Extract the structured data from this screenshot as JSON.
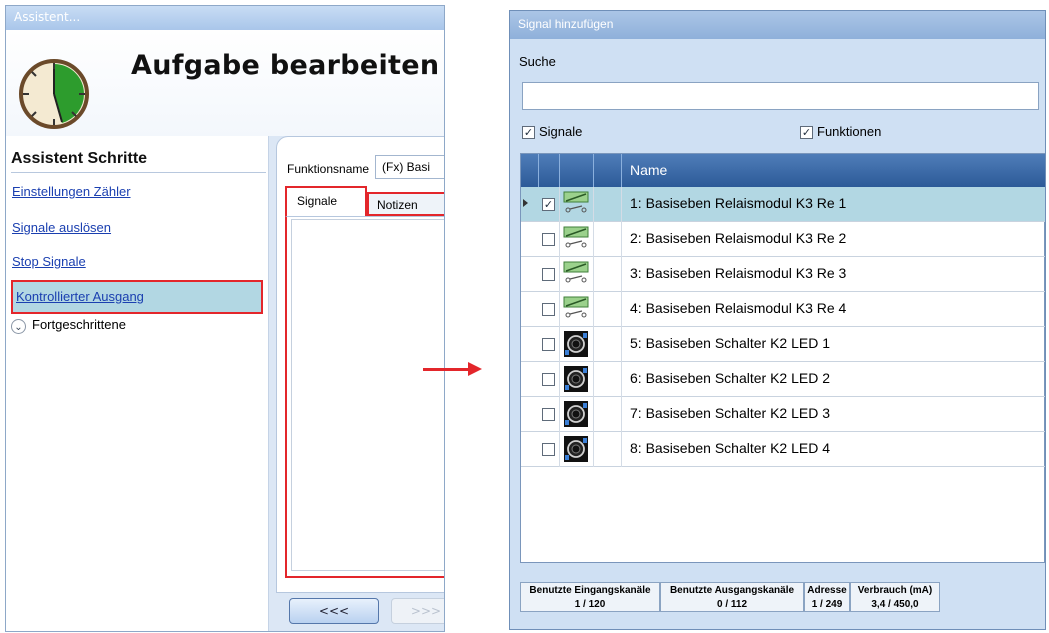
{
  "left_window": {
    "title": "Assistent...",
    "heading": "Aufgabe bearbeiten",
    "steps_title": "Assistent Schritte",
    "steps": [
      {
        "label": "Einstellungen Zähler"
      },
      {
        "label": "Signale auslösen"
      },
      {
        "label": "Stop Signale"
      },
      {
        "label": "Kontrollierter Ausgang",
        "selected": true
      }
    ],
    "advanced_label": "Fortgeschrittene",
    "function_name_label": "Funktionsname",
    "function_name_value": "(Fx) Basi",
    "tabs": [
      {
        "label": "Signale",
        "active": true
      },
      {
        "label": "Notizen",
        "active": false
      }
    ],
    "back_button": "<<<",
    "next_button": ">>>"
  },
  "dialog": {
    "title": "Signal hinzufügen",
    "search_label": "Suche",
    "search_value": "",
    "filter_signals": {
      "label": "Signale",
      "checked": true
    },
    "filter_functions": {
      "label": "Funktionen",
      "checked": true
    },
    "column_name": "Name",
    "rows": [
      {
        "text": "1: Basiseben Relaismodul K3 Re 1",
        "checked": true,
        "selected": true,
        "icon": "relay-icon"
      },
      {
        "text": "2: Basiseben Relaismodul K3 Re 2",
        "checked": false,
        "selected": false,
        "icon": "relay-icon"
      },
      {
        "text": "3: Basiseben Relaismodul K3 Re 3",
        "checked": false,
        "selected": false,
        "icon": "relay-icon"
      },
      {
        "text": "4: Basiseben Relaismodul K3 Re 4",
        "checked": false,
        "selected": false,
        "icon": "relay-icon"
      },
      {
        "text": "5: Basiseben Schalter K2 LED 1",
        "checked": false,
        "selected": false,
        "icon": "switch-led-icon"
      },
      {
        "text": "6: Basiseben Schalter K2 LED 2",
        "checked": false,
        "selected": false,
        "icon": "switch-led-icon"
      },
      {
        "text": "7: Basiseben Schalter K2 LED 3",
        "checked": false,
        "selected": false,
        "icon": "switch-led-icon"
      },
      {
        "text": "8: Basiseben Schalter K2 LED 4",
        "checked": false,
        "selected": false,
        "icon": "switch-led-icon"
      }
    ],
    "status": [
      {
        "header": "Benutzte Eingangskanäle",
        "value": "1 / 120"
      },
      {
        "header": "Benutzte Ausgangskanäle",
        "value": "0 / 112"
      },
      {
        "header": "Adresse",
        "value": "1 / 249"
      },
      {
        "header": "Verbrauch (mA)",
        "value": "3,4 / 450,0"
      }
    ]
  },
  "colors": {
    "highlight_red": "#e3262b",
    "selection_blue": "#b2d7e3",
    "header_blue": "#3a6aa8"
  }
}
